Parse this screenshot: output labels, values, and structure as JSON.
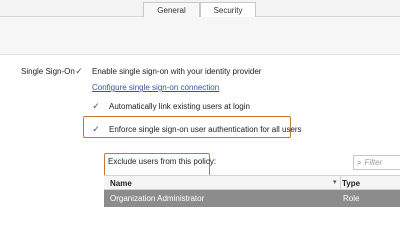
{
  "tabs": [
    {
      "label": "General",
      "selected": false
    },
    {
      "label": "Security",
      "selected": true
    }
  ],
  "sso": {
    "section_label": "Single Sign-On",
    "enable_label": "Enable single sign-on with your identity provider",
    "enable_checked": true,
    "configure_link": "Configure single sign-on connection",
    "auto_link_label": "Automatically link existing users at login",
    "auto_link_checked": true,
    "enforce_label": "Enforce single sign-on user authentication for all users",
    "enforce_checked": true
  },
  "exclude": {
    "label": "Exclude users from this policy:",
    "filter_placeholder": "Filter",
    "columns": [
      "Name",
      "Type"
    ],
    "rows": [
      {
        "name": "Organization Administrator",
        "type": "Role",
        "selected": true
      }
    ]
  },
  "colors": {
    "highlight_border": "#c7782e",
    "link": "#2b56b0",
    "checkmark": "#2e4f9a",
    "selected_row": "#8c8c8c"
  },
  "icons": {
    "checkbox": "check-icon",
    "filter": "magnifier-icon",
    "sort": "sort-down-icon"
  }
}
